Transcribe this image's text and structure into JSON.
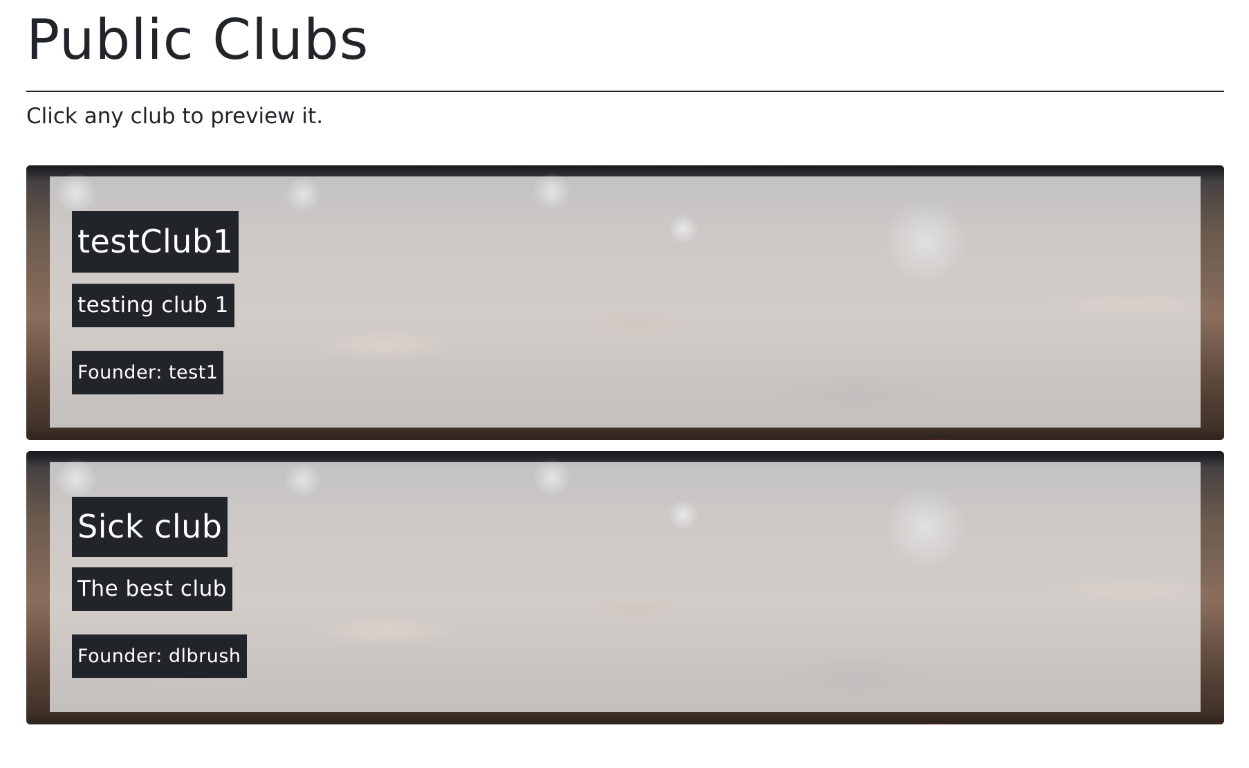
{
  "page": {
    "title": "Public Clubs",
    "intro": "Click any club to preview it."
  },
  "clubs": [
    {
      "name": "testClub1",
      "description": "testing club 1",
      "founder": "Founder: test1"
    },
    {
      "name": "Sick club",
      "description": "The best club",
      "founder": "Founder: dlbrush"
    }
  ],
  "colors": {
    "text": "#212529",
    "tag_background": "#212529",
    "tag_text": "#ffffff",
    "card_overlay": "#e8e8e8"
  },
  "icons": {
    "card_background": "concert-crowd-photo"
  }
}
